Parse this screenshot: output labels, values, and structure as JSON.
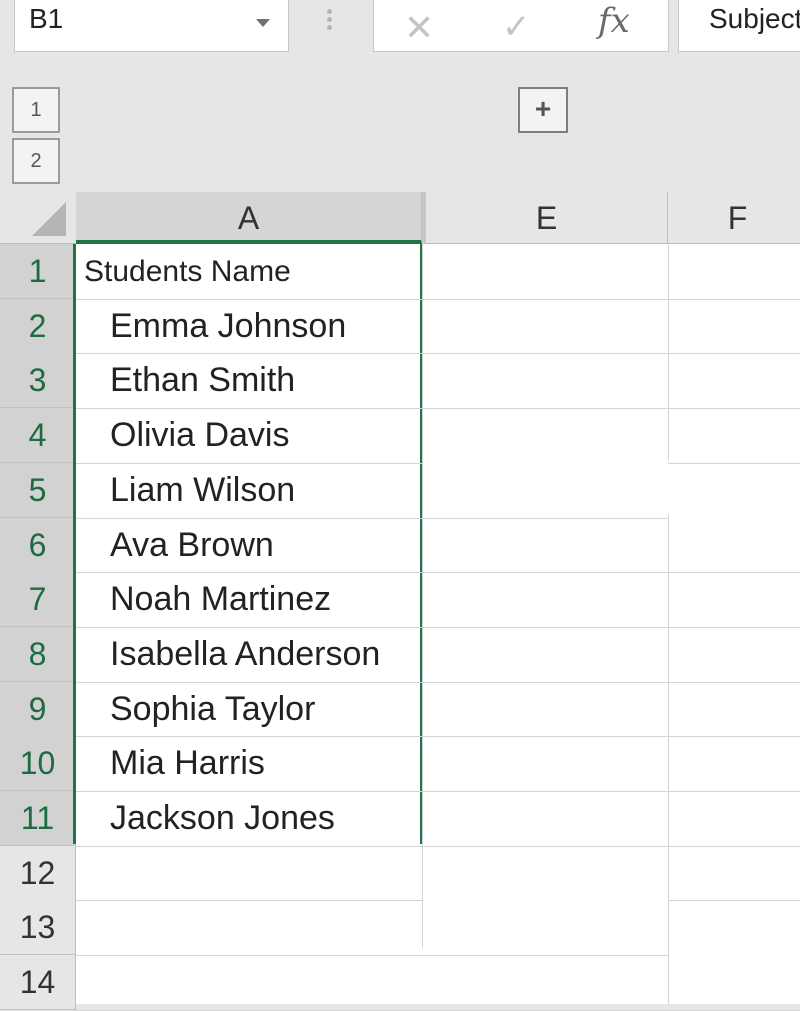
{
  "formula_bar": {
    "name_box": "B1",
    "formula": "Subject"
  },
  "outline": {
    "levels": [
      "1",
      "2"
    ],
    "expand_symbol": "+"
  },
  "columns": [
    "A",
    "E",
    "F"
  ],
  "rows": [
    "1",
    "2",
    "3",
    "4",
    "5",
    "6",
    "7",
    "8",
    "9",
    "10",
    "11",
    "12",
    "13",
    "14"
  ],
  "cells": {
    "A": [
      "Students Name",
      "Emma Johnson",
      "Ethan Smith",
      "Olivia Davis",
      "Liam Wilson",
      "Ava Brown",
      "Noah Martinez",
      "Isabella Anderson",
      "Sophia Taylor",
      "Mia Harris",
      "Jackson Jones",
      "",
      "",
      ""
    ]
  },
  "colors": {
    "selection": "#217346",
    "header_bg": "#e6e6e6",
    "selected_header_bg": "#d2d2d2"
  },
  "icons": [
    "dropdown-caret-icon",
    "cancel-icon",
    "enter-icon",
    "fx-icon",
    "expand-plus-icon",
    "select-all-icon"
  ]
}
